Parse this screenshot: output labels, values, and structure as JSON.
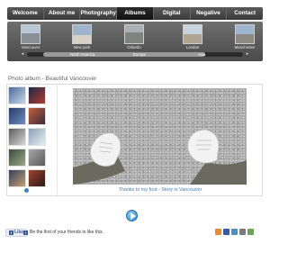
{
  "nav": {
    "items": [
      {
        "label": "Welcome",
        "active": false
      },
      {
        "label": "About me",
        "active": false
      },
      {
        "label": "Photography",
        "active": false
      },
      {
        "label": "Albums",
        "active": true
      },
      {
        "label": "Digital",
        "active": false
      },
      {
        "label": "Negative",
        "active": false
      },
      {
        "label": "Contact",
        "active": false
      }
    ]
  },
  "destinations": {
    "items": [
      {
        "label": "Vancouver",
        "icon": "city-photo"
      },
      {
        "label": "New york",
        "icon": "city-photo"
      },
      {
        "label": "Orlando",
        "icon": "city-photo"
      },
      {
        "label": "London",
        "icon": "city-photo"
      },
      {
        "label": "Manchester",
        "icon": "city-photo"
      }
    ],
    "regions": [
      "North America",
      "Europe",
      "Asia"
    ]
  },
  "album": {
    "title": "Photo album - Beautiful Vancouver",
    "caption": "Thanks to my foot - Story in Vancouver",
    "photo_subject": "feet-on-gravel-photo"
  },
  "footer": {
    "like_label": "Like",
    "like_text": "Be the first of your friends to like this."
  },
  "colors": {
    "nav_bg": "#4a4a4a",
    "accent_blue": "#3c7fbf",
    "facebook_blue": "#3b5998"
  }
}
